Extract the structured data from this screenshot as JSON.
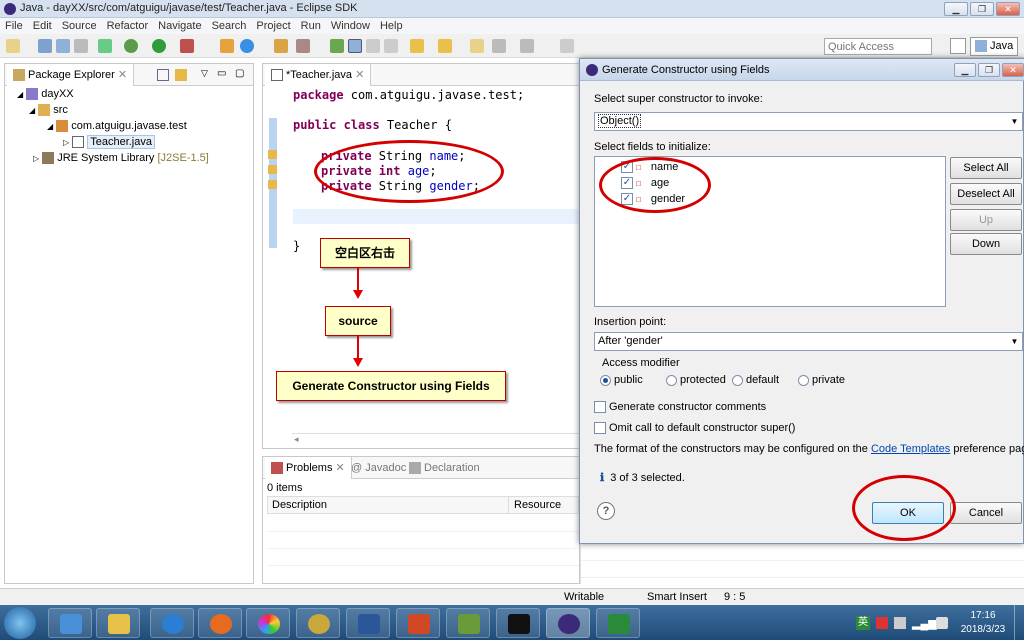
{
  "window": {
    "title": "Java - dayXX/src/com/atguigu/javase/test/Teacher.java - Eclipse SDK"
  },
  "menu": [
    "File",
    "Edit",
    "Source",
    "Refactor",
    "Navigate",
    "Search",
    "Project",
    "Run",
    "Window",
    "Help"
  ],
  "toolbar": {
    "quick_access_placeholder": "Quick Access",
    "perspective": "Java"
  },
  "package_explorer": {
    "tab": "Package Explorer",
    "project": "dayXX",
    "src": "src",
    "package": "com.atguigu.javase.test",
    "file": "Teacher.java",
    "jre": "JRE System Library",
    "jre_version": "[J2SE-1.5]"
  },
  "editor": {
    "tab": "*Teacher.java",
    "lines": {
      "pkg_kw": "package",
      "pkg_name": " com.atguigu.javase.test;",
      "class_kw": "public class",
      "class_name": " Teacher {",
      "f1_kw": "private",
      "f1_type": " String ",
      "f1_name": "name",
      "f2_kw": "private",
      "f2_type": " int",
      "f2_name": "age",
      "f3_kw": "private",
      "f3_type": " String ",
      "f3_name": "gender",
      "semi": ";",
      "close": "}"
    }
  },
  "annotations": {
    "step1": "空白区右击",
    "step2": "source",
    "step3": "Generate Constructor using Fields"
  },
  "bottom_panel": {
    "tabs": [
      "Problems",
      "Javadoc",
      "Declaration"
    ],
    "count": "0 items",
    "col_description": "Description",
    "col_resource": "Resource"
  },
  "status": {
    "writable": "Writable",
    "insert": "Smart Insert",
    "position": "9 : 5"
  },
  "dialog": {
    "title": "Generate Constructor using Fields",
    "super_label": "Select super constructor to invoke:",
    "super_value": "Object()",
    "fields_label": "Select fields to initialize:",
    "fields": [
      "name",
      "age",
      "gender"
    ],
    "select_all": "Select All",
    "deselect_all": "Deselect All",
    "up": "Up",
    "down": "Down",
    "insertion_label": "Insertion point:",
    "insertion_value": "After 'gender'",
    "access_label": "Access modifier",
    "access": [
      "public",
      "protected",
      "default",
      "private"
    ],
    "gen_comments": "Generate constructor comments",
    "omit_super": "Omit call to default constructor super()",
    "format_prefix": "The format of the constructors may be configured on the ",
    "format_link": "Code Templates",
    "format_suffix": " preference page.",
    "selected_info": "3 of 3 selected.",
    "ok": "OK",
    "cancel": "Cancel"
  },
  "tray": {
    "ime": "英",
    "time": "17:16",
    "date": "2018/3/23"
  }
}
